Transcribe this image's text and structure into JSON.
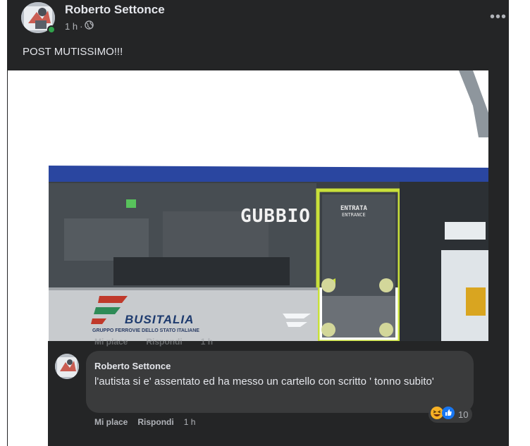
{
  "post": {
    "author": "Roberto Settonce",
    "time": "1 h",
    "separator": "·",
    "privacy_icon": "globe-icon",
    "more_label": "•••",
    "text": "POST MUTISSIMO!!!"
  },
  "photo": {
    "bus_destination": "GUBBIO",
    "door_label": "ENTRATA",
    "door_label_en": "ENTRANCE",
    "brand_name": "BUSITALIA",
    "brand_sub": "GRUPPO FERROVIE DELLO STATO ITALIANE"
  },
  "comment": {
    "author": "Roberto Settonce",
    "text": "l'autista si e' assentato ed ha messo un cartello con scritto ' tonno subito'",
    "reaction_icons": [
      "haha-icon",
      "like-icon"
    ],
    "reaction_count": "10",
    "like_label": "Mi place",
    "reply_label": "Rispondi",
    "time": "1 h"
  },
  "colors": {
    "card_bg": "#242526",
    "bubble_bg": "#3a3b3c",
    "text_primary": "#e4e6eb",
    "text_secondary": "#b0b3b8",
    "online": "#31a24c",
    "bus_yellow": "#c9e03a",
    "bus_blue": "#2a46a0"
  }
}
